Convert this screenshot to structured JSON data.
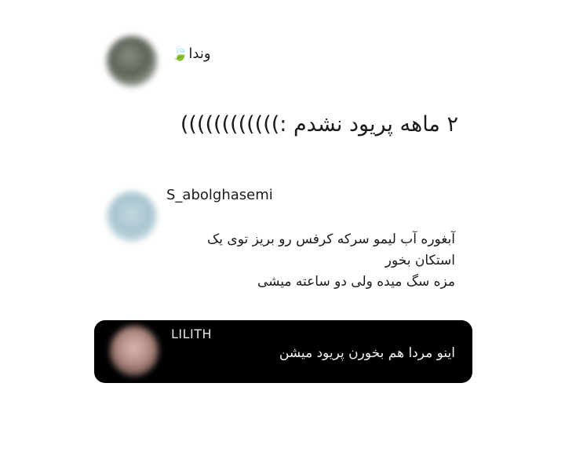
{
  "comments": [
    {
      "username": "وندا",
      "badge_icon": "leaf-icon",
      "text": "۲ ماهه پریود نشدم :))))))))))))"
    },
    {
      "username": "S_abolghasemi",
      "lines": [
        "آبغوره آب لیمو سرکه کرفس رو بریز توی یک",
        "استکان بخور",
        "مزه سگ میده ولی دو ساعته میشی"
      ]
    },
    {
      "username": "LILITH",
      "text": "اینو مردا هم بخورن پریود میشن",
      "card_color": "#000000"
    }
  ]
}
